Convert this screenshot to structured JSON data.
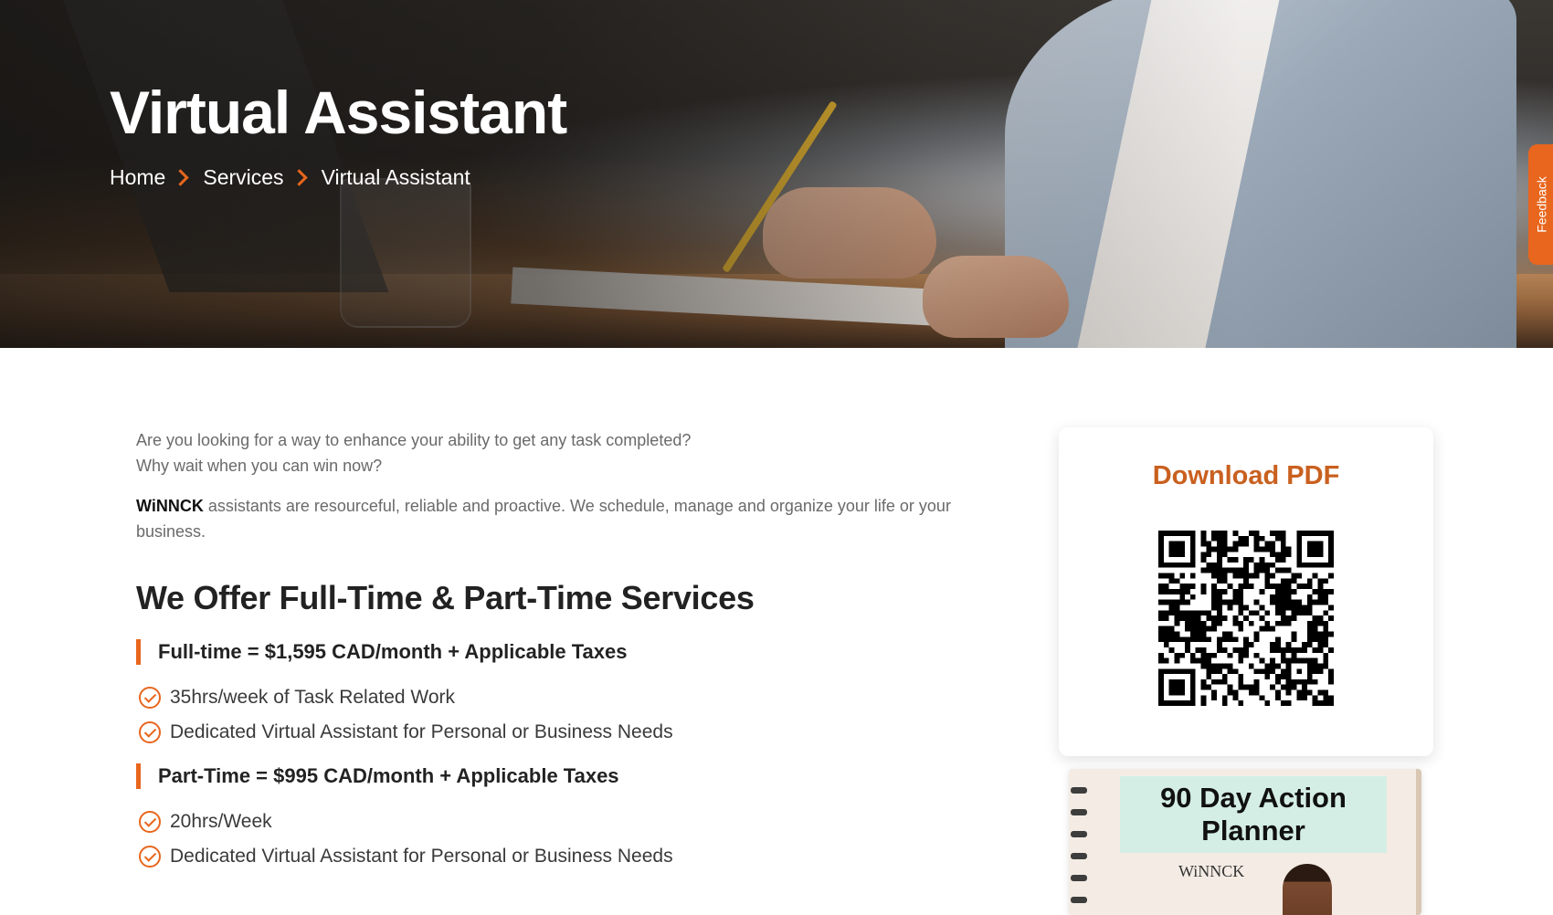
{
  "hero": {
    "title": "Virtual Assistant",
    "breadcrumb": [
      {
        "label": "Home"
      },
      {
        "label": "Services"
      },
      {
        "label": "Virtual Assistant"
      }
    ]
  },
  "feedback_tab": {
    "label": "Feedback"
  },
  "intro": {
    "line1": "Are you looking for a way to enhance your ability to get any task completed?",
    "line2": "Why wait when you can win now?",
    "brand": "WiNNCK",
    "description": " assistants are resourceful, reliable and proactive. We schedule, manage and organize your life or your business."
  },
  "services": {
    "heading": "We Offer Full-Time & Part-Time Services",
    "plans": [
      {
        "title": "Full-time = $1,595 CAD/month + Applicable Taxes",
        "features": [
          "35hrs/week of Task Related Work",
          "Dedicated Virtual Assistant for Personal or Business Needs"
        ]
      },
      {
        "title": "Part-Time = $995 CAD/month + Applicable Taxes",
        "features": [
          "20hrs/Week",
          "Dedicated Virtual Assistant for Personal or Business Needs"
        ]
      }
    ]
  },
  "sidebar": {
    "download_label": "Download PDF",
    "planner": {
      "title": "90 Day Action Planner",
      "brand": "WiNNCK"
    }
  },
  "colors": {
    "accent": "#e8661d",
    "download_link": "#c9601f",
    "planner_banner": "#d4eee5"
  },
  "icons": {
    "breadcrumb_separator": "chevron-right-icon",
    "feature_bullet": "check-circle-icon",
    "feedback": "speech-bubble-icon"
  }
}
